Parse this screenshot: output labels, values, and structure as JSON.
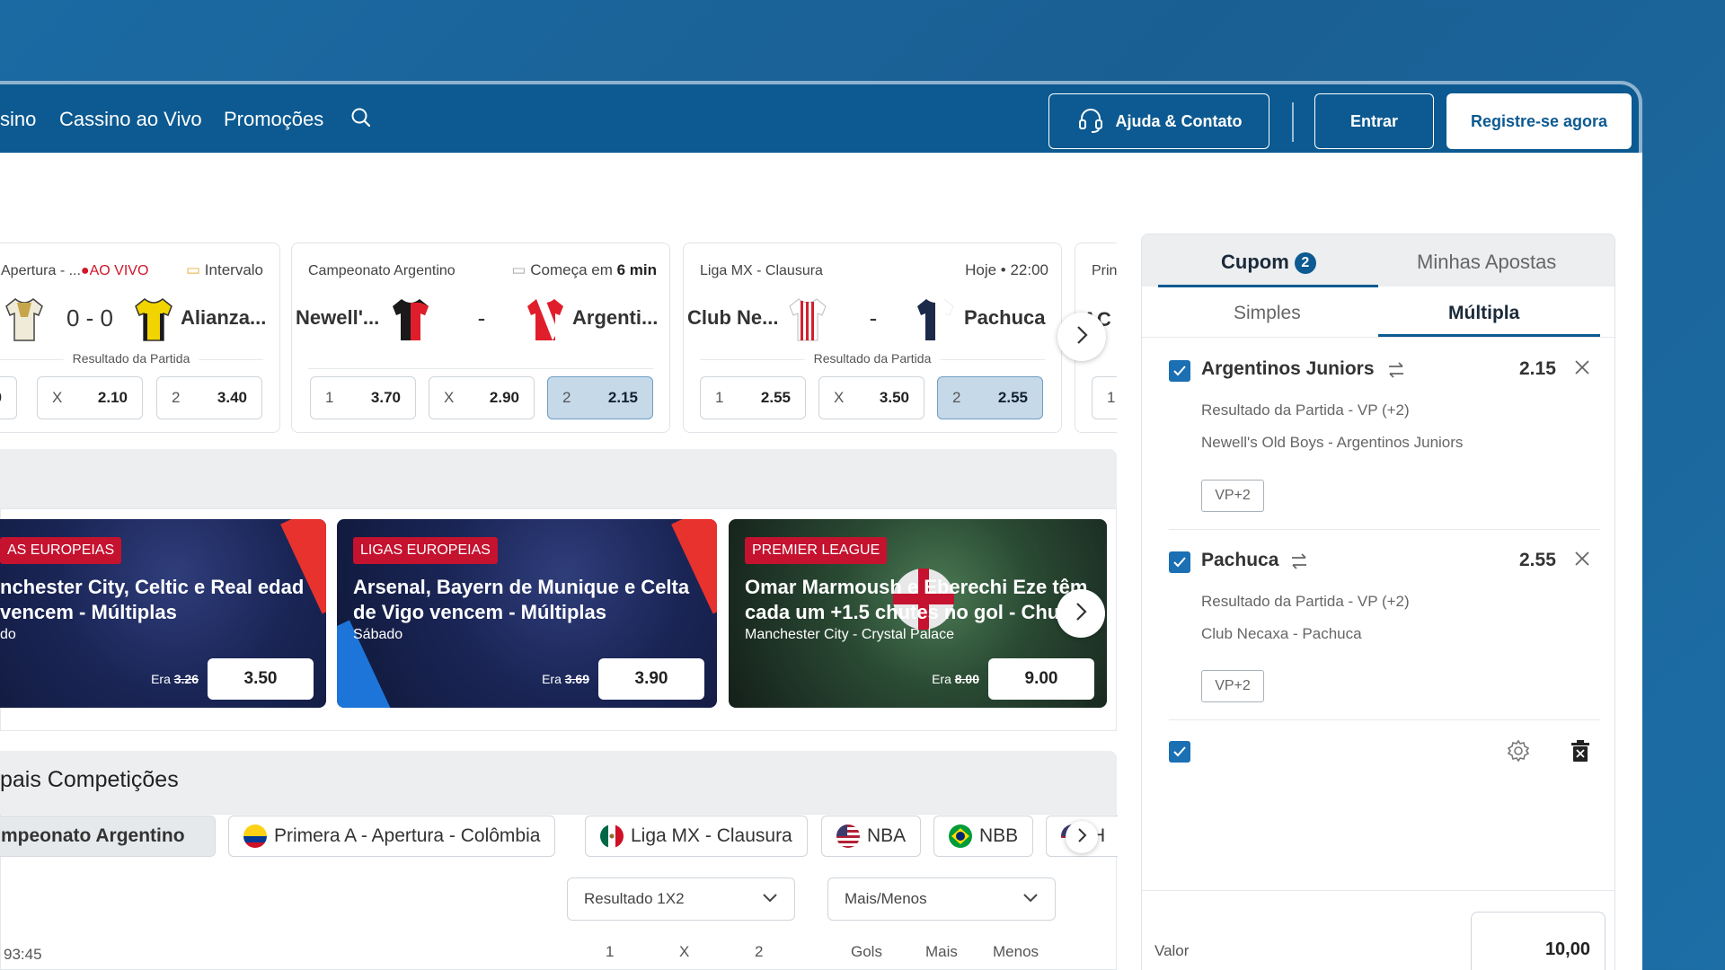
{
  "nav": {
    "links": [
      "sino",
      "Cassino ao Vivo",
      "Promoções"
    ],
    "help_label": "Ajuda & Contato",
    "login_label": "Entrar",
    "register_label": "Registre-se agora"
  },
  "matches": [
    {
      "league": "Apertura - ...",
      "live_label": "AO VIVO",
      "status": "Intervalo",
      "home": "",
      "score": "0 - 0",
      "away": "Alianza...",
      "market": "Resultado da Partida",
      "odds": [
        {
          "label": "",
          "value": "0"
        },
        {
          "label": "X",
          "value": "2.10"
        },
        {
          "label": "2",
          "value": "3.40"
        }
      ]
    },
    {
      "league": "Campeonato Argentino",
      "status_prefix": "Começa em",
      "status_bold": "6 min",
      "home": "Newell'...",
      "score": "-",
      "away": "Argenti...",
      "market": "",
      "odds": [
        {
          "label": "1",
          "value": "3.70"
        },
        {
          "label": "X",
          "value": "2.90"
        },
        {
          "label": "2",
          "value": "2.15"
        }
      ],
      "selected_odd": 2
    },
    {
      "league": "Liga MX - Clausura",
      "status": "Hoje • 22:00",
      "home": "Club Ne...",
      "score": "-",
      "away": "Pachuca",
      "market": "Resultado da Partida",
      "odds": [
        {
          "label": "1",
          "value": "2.55"
        },
        {
          "label": "X",
          "value": "3.50"
        },
        {
          "label": "2",
          "value": "2.55"
        }
      ],
      "selected_odd": 2
    },
    {
      "league": "Prin",
      "home": "AC d",
      "odds": [
        {
          "label": "1",
          "value": ""
        }
      ]
    }
  ],
  "promos": [
    {
      "tag": "AS EUROPEIAS",
      "title": "nchester City, Celtic e Real edad vencem - Múltiplas",
      "subtitle": "do",
      "was_label": "Era",
      "was_value": "3.26",
      "odd": "3.50"
    },
    {
      "tag": "LIGAS EUROPEIAS",
      "title": "Arsenal, Bayern de Munique e Celta de Vigo vencem - Múltiplas",
      "subtitle": "Sábado",
      "was_label": "Era",
      "was_value": "3.69",
      "odd": "3.90"
    },
    {
      "tag": "PREMIER LEAGUE",
      "title": "Omar Marmoush e Eberechi Eze têm cada um +1.5 chutes no gol - Chute",
      "subtitle": "Manchester City - Crystal Palace",
      "was_label": "Era",
      "was_value": "8.00",
      "odd": "9.00"
    }
  ],
  "competitions": {
    "title": "pais Competições",
    "chips": [
      "mpeonato Argentino",
      "Primera A - Apertura - Colômbia",
      "Liga MX - Clausura",
      "NBA",
      "NBB",
      "H"
    ],
    "dropdowns": [
      "Resultado 1X2",
      "Mais/Menos"
    ],
    "time_fragment": "93:45",
    "columns": [
      "1",
      "X",
      "2",
      "Gols",
      "Mais",
      "Menos"
    ]
  },
  "betslip": {
    "tab_coupon": "Cupom",
    "coupon_count": "2",
    "tab_my_bets": "Minhas Apostas",
    "subtab_single": "Simples",
    "subtab_multiple": "Múltipla",
    "selections": [
      {
        "name": "Argentinos Juniors",
        "odd": "2.15",
        "market": "Resultado da Partida - VP (+2)",
        "event": "Newell's Old Boys - Argentinos Juniors",
        "tag": "VP+2"
      },
      {
        "name": "Pachuca",
        "odd": "2.55",
        "market": "Resultado da Partida - VP (+2)",
        "event": "Club Necaxa - Pachuca",
        "tag": "VP+2"
      }
    ],
    "stake_label": "Valor",
    "stake_value": "10,00"
  },
  "colors": {
    "brand": "#0c5a91",
    "live": "#d0172a",
    "promo_tag": "#c4122f",
    "selected_odd": "#c6d9e9"
  }
}
